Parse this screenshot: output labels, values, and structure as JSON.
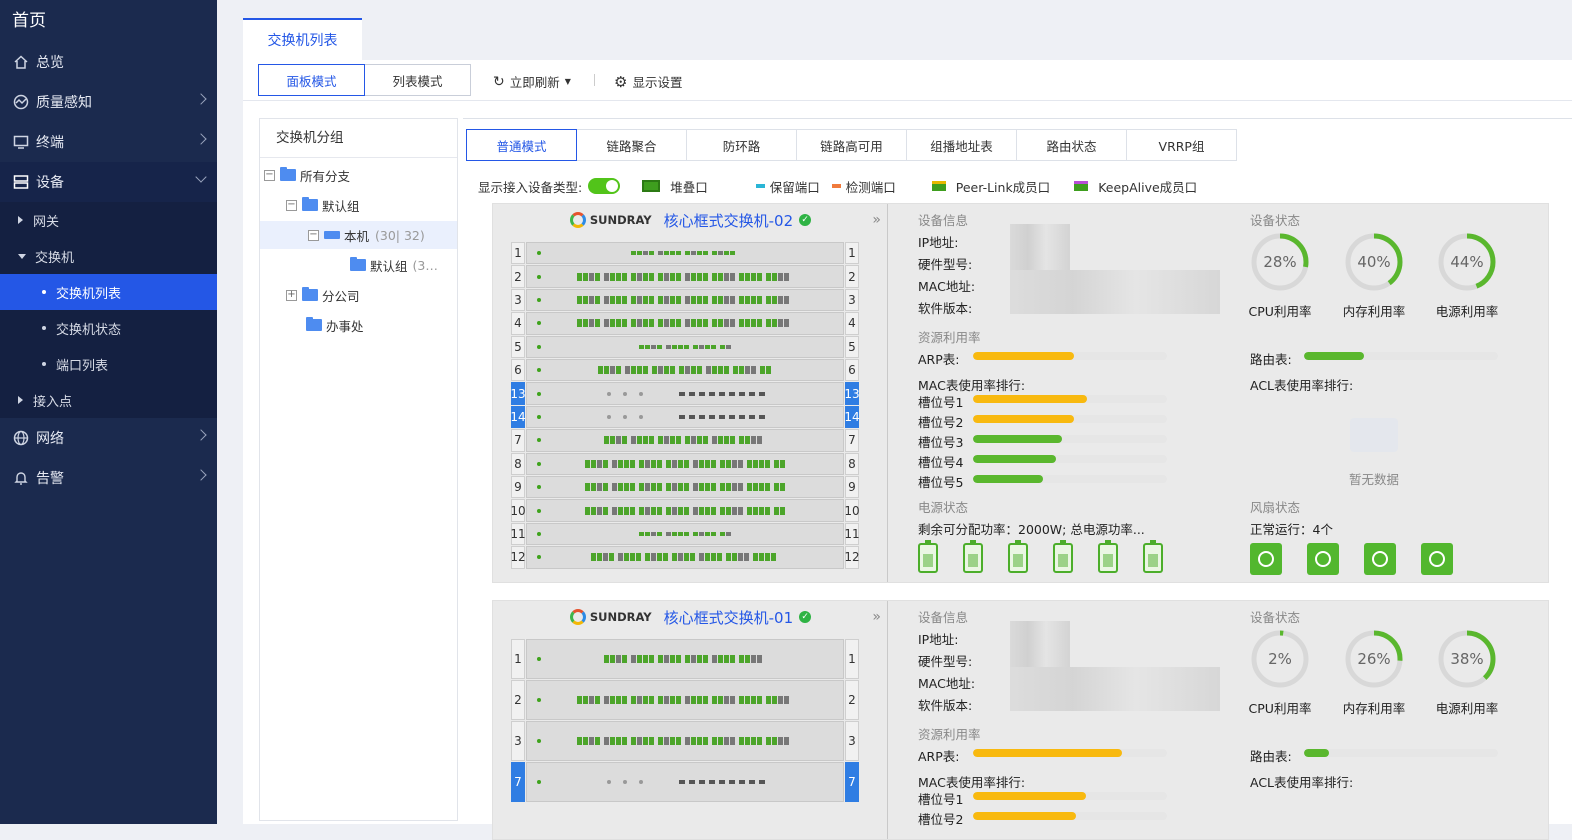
{
  "sidebar": {
    "home": "首页",
    "items": [
      {
        "label": "总览",
        "icon": "home-icon"
      },
      {
        "label": "质量感知",
        "icon": "dashboard-icon"
      },
      {
        "label": "终端",
        "icon": "monitor-icon"
      },
      {
        "label": "设备",
        "icon": "server-icon"
      },
      {
        "label": "网络",
        "icon": "globe-icon"
      },
      {
        "label": "告警",
        "icon": "bell-icon"
      }
    ],
    "device_sub": {
      "gateway": "网关",
      "switch": "交换机",
      "switch_list": "交换机列表",
      "switch_status": "交换机状态",
      "port_list": "端口列表",
      "ap": "接入点"
    }
  },
  "main_tab": "交换机列表",
  "toolbar": {
    "panel_mode": "面板模式",
    "list_mode": "列表模式",
    "refresh": "立即刷新",
    "display_settings": "显示设置"
  },
  "group": {
    "title": "交换机分组",
    "tree": {
      "all": "所有分支",
      "default": "默认组",
      "local": "本机",
      "local_count": "(30| 32)",
      "default_child": "默认组",
      "default_child_count": "(3…",
      "branch": "分公司",
      "office": "办事处"
    }
  },
  "subtabs": [
    "普通模式",
    "链路聚合",
    "防环路",
    "链路高可用",
    "组播地址表",
    "路由状态",
    "VRRP组"
  ],
  "legend": {
    "show_type": "显示接入设备类型:",
    "stack": "堆叠口",
    "reserved": "保留端口",
    "detect": "检测端口",
    "peerlink": "Peer-Link成员口",
    "keepalive": "KeepAlive成员口"
  },
  "labels": {
    "brand": "SUNDRAY",
    "device_info": "设备信息",
    "device_status": "设备状态",
    "ip": "IP地址:",
    "model": "硬件型号:",
    "mac": "MAC地址:",
    "sw": "软件版本:",
    "resource": "资源利用率",
    "arp": "ARP表:",
    "route": "路由表:",
    "mac_rank": "MAC表使用率排行:",
    "acl_rank": "ACL表使用率排行:",
    "no_data": "暂无数据",
    "cpu": "CPU利用率",
    "mem": "内存利用率",
    "power_rate": "电源利用率",
    "power_status": "电源状态",
    "fan_status": "风扇状态"
  },
  "devices": [
    {
      "name": "核心框式交换机-02",
      "slots": [
        "1",
        "2",
        "3",
        "4",
        "5",
        "6",
        "13",
        "14",
        "7",
        "8",
        "9",
        "10",
        "11",
        "12"
      ],
      "cpu": "28%",
      "cpu_v": 28,
      "mem": "40%",
      "mem_v": 40,
      "pwr": "44%",
      "pwr_v": 44,
      "arp_v": 52,
      "route_v": 31,
      "mac_slots": [
        {
          "label": "槽位号1",
          "v": 59
        },
        {
          "label": "槽位号2",
          "v": 52
        },
        {
          "label": "槽位号3",
          "v": 46
        },
        {
          "label": "槽位号4",
          "v": 43
        },
        {
          "label": "槽位号5",
          "v": 36
        }
      ],
      "power_text": "剩余可分配功率：2000W; 总电源功率...",
      "fan_text": "正常运行：4个"
    },
    {
      "name": "核心框式交换机-01",
      "slots": [
        "1",
        "2",
        "3",
        "7"
      ],
      "cpu": "2%",
      "cpu_v": 2,
      "mem": "26%",
      "mem_v": 26,
      "pwr": "38%",
      "pwr_v": 38,
      "arp_v": 77,
      "route_v": 13,
      "mac_slots": [
        {
          "label": "槽位号1",
          "v": 58
        },
        {
          "label": "槽位号2",
          "v": 53
        }
      ]
    }
  ],
  "colors": {
    "accent": "#2457e6",
    "sidebar": "#1b2a4e",
    "ok_green": "#52b72e",
    "bar_yellow": "#f8b90f",
    "bar_green": "#5ab72e",
    "reserved": "#2ab5d6",
    "detect": "#f07a3c"
  }
}
